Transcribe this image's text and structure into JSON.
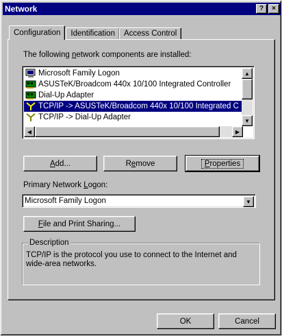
{
  "window": {
    "title": "Network",
    "help_btn": "?",
    "close_btn": "×"
  },
  "tabs": [
    {
      "label": "Configuration",
      "active": true
    },
    {
      "label": "Identification",
      "active": false
    },
    {
      "label": "Access Control",
      "active": false
    }
  ],
  "components_label": {
    "pre": "The following ",
    "accel": "n",
    "post": "etwork components are installed:"
  },
  "components": [
    {
      "label": "Microsoft Family Logon",
      "icon": "client-icon",
      "selected": false
    },
    {
      "label": "ASUSTeK/Broadcom 440x 10/100 Integrated Controller",
      "icon": "adapter-icon",
      "selected": false
    },
    {
      "label": "Dial-Up Adapter",
      "icon": "adapter-icon",
      "selected": false
    },
    {
      "label": "TCP/IP -> ASUSTeK/Broadcom 440x 10/100 Integrated C",
      "icon": "protocol-icon",
      "selected": true
    },
    {
      "label": "TCP/IP -> Dial-Up Adapter",
      "icon": "protocol-icon",
      "selected": false
    }
  ],
  "buttons": {
    "add": {
      "accel": "A",
      "rest": "dd..."
    },
    "remove": {
      "pre": "R",
      "accel": "e",
      "rest": "move"
    },
    "properties": {
      "accel": "P",
      "rest": "roperties"
    },
    "file_sharing": {
      "accel": "F",
      "rest": "ile and Print Sharing..."
    },
    "ok": "OK",
    "cancel": "Cancel"
  },
  "primary_logon": {
    "label_pre": "Primary Network ",
    "label_accel": "L",
    "label_post": "ogon:",
    "value": "Microsoft Family Logon"
  },
  "description": {
    "title": "Description",
    "text": "TCP/IP is the protocol you use to connect to the Internet and wide-area networks."
  },
  "colors": {
    "selection": "#000080",
    "face": "#c0c0c0",
    "titlebar": "#000080"
  }
}
